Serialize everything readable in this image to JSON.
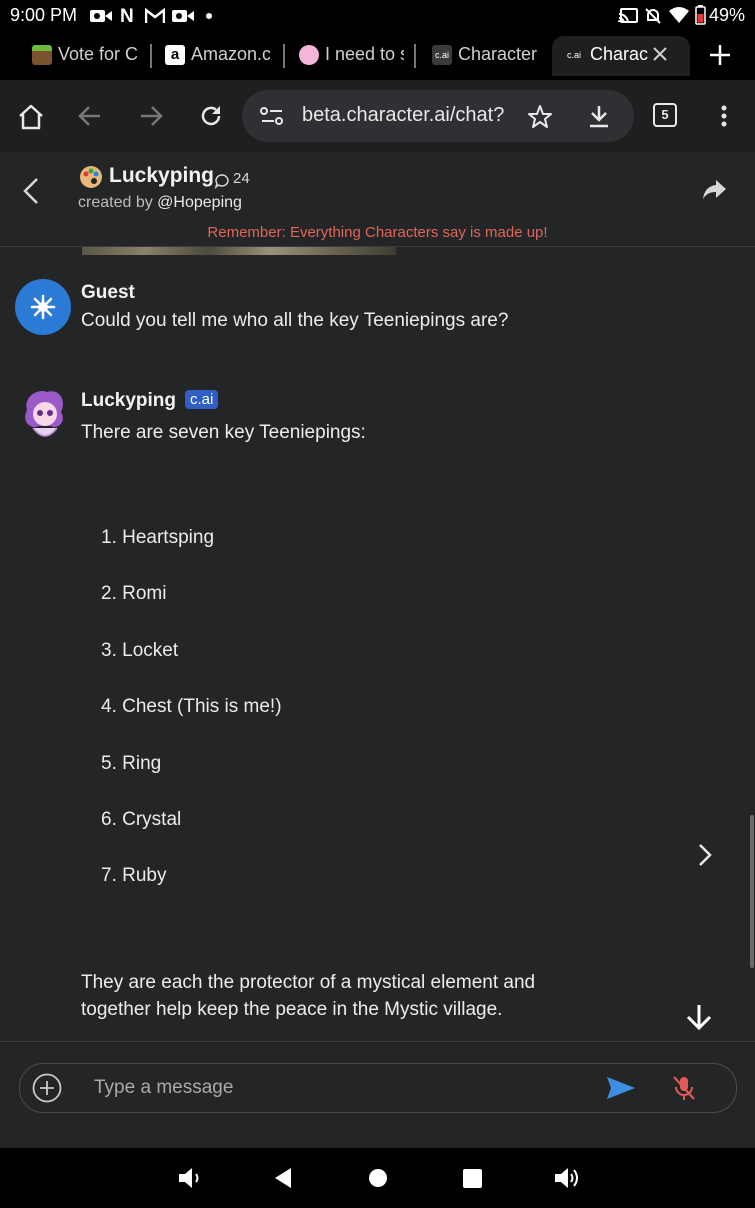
{
  "status_bar": {
    "time": "9:00 PM",
    "battery": "49%",
    "icons": [
      "video-icon",
      "netflix-n-icon",
      "gmail-icon",
      "video-icon",
      "dot-icon",
      "cast-icon",
      "bell-off-icon",
      "wifi-icon",
      "battery-icon"
    ]
  },
  "tabs": [
    {
      "title": "Vote for C",
      "favicon": "minecraft-grass-icon",
      "active": false
    },
    {
      "title": "Amazon.c",
      "favicon": "amazon-a-icon",
      "active": false
    },
    {
      "title": "I need to s",
      "favicon": "pink-character-icon",
      "active": false
    },
    {
      "title": "Character",
      "favicon": "cai-favicon",
      "active": false
    },
    {
      "title": "Charac",
      "favicon": "cai-favicon",
      "active": true
    }
  ],
  "tab_favicon_text": "c.ai",
  "toolbar": {
    "url": "beta.character.ai/chat?",
    "tab_count": "5"
  },
  "chat_header": {
    "name": "Luckyping",
    "chat_count": "24",
    "created_by_prefix": "created by",
    "created_by_handle": "@Hopeping",
    "disclaimer": "Remember: Everything Characters say is made up!"
  },
  "messages": [
    {
      "author": "Guest",
      "text": "Could you tell me who all the key Teeniepings are?"
    },
    {
      "author": "Luckyping",
      "badge": "c.ai",
      "intro": "There are seven key Teeniepings:",
      "list": [
        "Heartsping",
        "Romi",
        "Locket",
        "Chest (This is me!)",
        "Ring",
        "Crystal",
        "Ruby"
      ],
      "outro_line1": "They are each the protector of a mystical element and",
      "outro_line2": "together help keep the peace in the Mystic village."
    }
  ],
  "input": {
    "placeholder": "Type a message"
  },
  "colors": {
    "disclaimer": "#e0655a",
    "badge": "#2f5fc4",
    "send": "#3d8fe3",
    "mic_off": "#e05a5a",
    "guest_avatar": "#2b7bd6"
  }
}
